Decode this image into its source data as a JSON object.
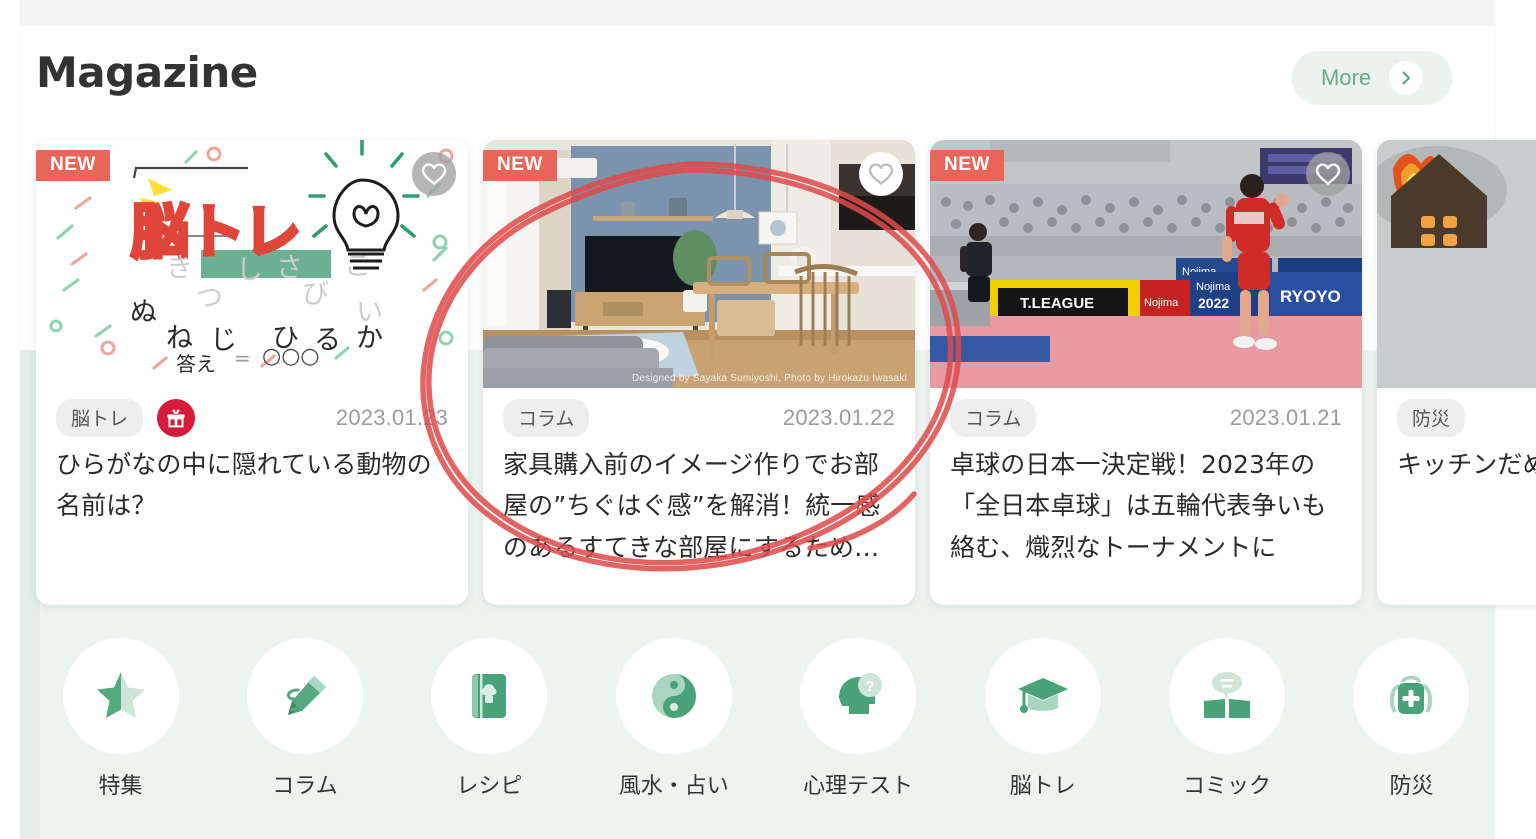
{
  "header": {
    "title": "Magazine",
    "more_label": "More",
    "more_chevron_icon": "chevron-right-icon"
  },
  "cards": [
    {
      "badge": "NEW",
      "favorite_icon": "heart-outline-icon",
      "tag": "脳トレ",
      "gift_icon": "gift-icon",
      "date": "2023.01.23",
      "title": "ひらがなの中に隠れている動物の名前は？",
      "media_kind": "brain-training-illustration",
      "illustration": {
        "heading": "脳トレ",
        "bulb_icon": "lightbulb-icon",
        "kana_faint": [
          "き",
          "し",
          "さ",
          "こ"
        ],
        "kana_mid": [
          "つ",
          "び",
          "い"
        ],
        "kana_row": [
          "ぬ",
          "ね",
          "じ",
          "ひ",
          "る",
          "か"
        ],
        "answer_label": "答え",
        "answer_equals": "=",
        "answer_blanks": "○○○"
      }
    },
    {
      "badge": "NEW",
      "favorite_icon": "heart-outline-icon",
      "tag": "コラム",
      "date": "2023.01.22",
      "title": "家具購入前のイメージ作りでお部屋の”ちぐはぐ感”を解消！統一感のあるすてきな部屋にするため…",
      "media_kind": "living-room-photo",
      "photo_credit": "Designed by Sayaka Sumiyoshi, Photo by Hirokazu Iwasaki"
    },
    {
      "badge": "NEW",
      "favorite_icon": "heart-outline-icon",
      "tag": "コラム",
      "date": "2023.01.21",
      "title": "卓球の日本一決定戦！2023年の「全日本卓球」は五輪代表争いも絡む、熾烈なトーナメントに",
      "media_kind": "table-tennis-photo",
      "photo_signage": [
        "T.LEAGUE",
        "Nojima",
        "2022",
        "RYOYO"
      ]
    },
    {
      "badge": "",
      "favorite_icon": "",
      "tag": "防災",
      "date": "",
      "title": "キッチンだめて知って知識",
      "media_kind": "burning-paper-house-photo"
    }
  ],
  "categories": [
    {
      "label": "特集",
      "icon": "star-icon"
    },
    {
      "label": "コラム",
      "icon": "pencil-icon"
    },
    {
      "label": "レシピ",
      "icon": "recipe-book-icon"
    },
    {
      "label": "風水・占い",
      "icon": "yin-yang-icon"
    },
    {
      "label": "心理テスト",
      "icon": "head-question-icon"
    },
    {
      "label": "脳トレ",
      "icon": "graduation-cap-icon"
    },
    {
      "label": "コミック",
      "icon": "comic-book-icon"
    },
    {
      "label": "防災",
      "icon": "emergency-backpack-icon"
    }
  ],
  "annotation": {
    "kind": "hand-drawn-red-ellipse",
    "color": "#e04a4a",
    "targets_card_index": 1
  },
  "colors": {
    "accent_green": "#5eab83",
    "badge_red": "#e8655a",
    "gift_red": "#d51b3c",
    "mint_bg": "#edf4f0",
    "text_dark": "#2b2b2b",
    "date_grey": "#9b9b9b"
  }
}
